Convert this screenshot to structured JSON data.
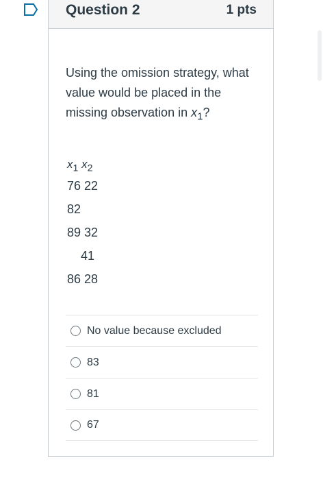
{
  "question": {
    "title": "Question 2",
    "points": "1 pts",
    "text_before": "Using the omission strategy, what value would be placed in the missing observation in ",
    "text_var": "x",
    "text_sub": "1",
    "text_after": "?"
  },
  "table": {
    "headers": [
      {
        "var": "x",
        "sub": "1"
      },
      {
        "var": "x",
        "sub": "2"
      }
    ],
    "rows": [
      "76 22",
      "82",
      "89 32",
      "    41",
      "86 28"
    ]
  },
  "options": [
    {
      "label": "No value because excluded"
    },
    {
      "label": "83"
    },
    {
      "label": "81"
    },
    {
      "label": "67"
    }
  ],
  "colors": {
    "accent": "#0770a3",
    "text": "#2d3b45",
    "border": "#c7cdd1",
    "header_bg": "#f5f5f5"
  },
  "icons": {
    "flag": "bookmark-flag-icon"
  }
}
